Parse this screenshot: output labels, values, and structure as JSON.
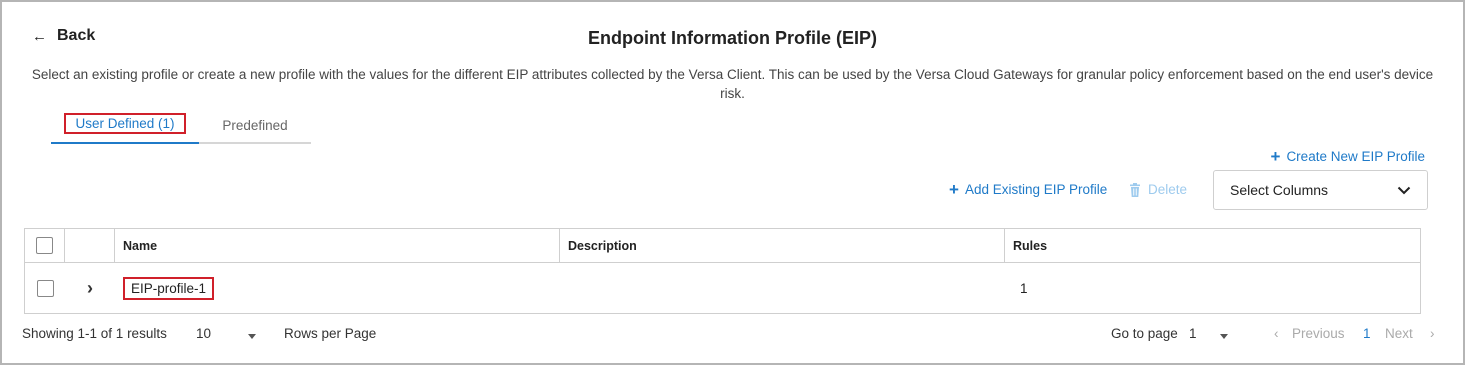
{
  "header": {
    "back_label": "Back",
    "title": "Endpoint Information Profile (EIP)",
    "description": "Select an existing profile or create a new profile with the values for the different EIP attributes collected by the Versa Client. This can be used by the Versa Cloud Gateways for granular policy enforcement based on the end user's device risk."
  },
  "tabs": [
    {
      "label": "User Defined (1)",
      "active": true
    },
    {
      "label": "Predefined",
      "active": false
    }
  ],
  "toolbar": {
    "create_label": "Create New EIP Profile",
    "add_label": "Add Existing EIP Profile",
    "delete_label": "Delete",
    "select_columns_label": "Select Columns"
  },
  "table": {
    "columns": [
      "Name",
      "Description",
      "Rules"
    ],
    "rows": [
      {
        "name": "EIP-profile-1",
        "description": "",
        "rules": "1"
      }
    ]
  },
  "pagination": {
    "summary": "Showing 1-1 of 1 results",
    "page_size": "10",
    "rows_per_page_label": "Rows per Page",
    "go_to_page_label": "Go to page",
    "go_to_page_value": "1",
    "previous_label": "Previous",
    "current_page": "1",
    "next_label": "Next"
  },
  "colors": {
    "accent": "#1f7ac8",
    "highlight": "#d0202a",
    "disabled": "#9ecbee"
  },
  "icons": [
    "arrow-left-icon",
    "plus-icon",
    "trash-icon",
    "chevron-down-icon",
    "chevron-right-icon",
    "caret-down-icon",
    "chevron-left-icon"
  ]
}
